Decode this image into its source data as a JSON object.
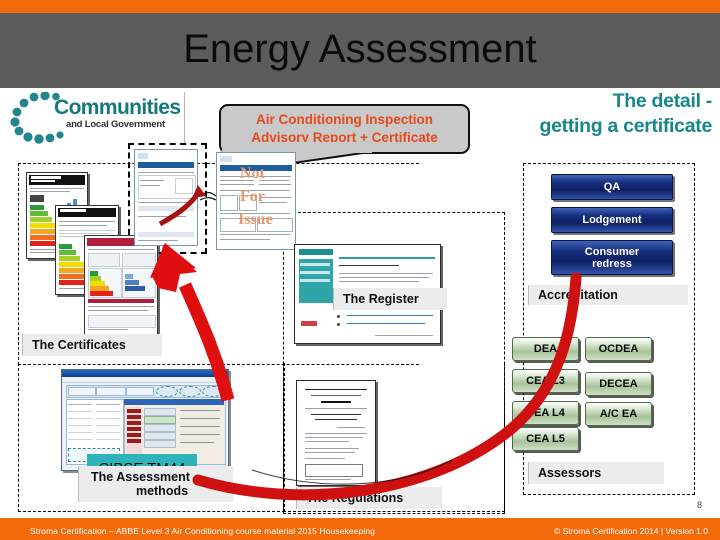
{
  "header": {
    "title": "Energy Assessment",
    "bar_color": "#f26a0a",
    "band_color": "#5c5c5c"
  },
  "logo": {
    "name": "Communities",
    "subtitle": "and Local Government",
    "color": "#13797f"
  },
  "callout": {
    "line1": "Air Conditioning Inspection",
    "line2": "Advisory Report + Certificate",
    "text_color": "#e8491c"
  },
  "right_heading": {
    "line1": "The detail -",
    "line2": "getting a certificate",
    "color": "#17878c"
  },
  "groups": {
    "certificates_label": "The Certificates",
    "register_label": "The Register",
    "assessment_label_line1": "The Assessment",
    "assessment_label_line2": "methods",
    "regulations_label": "The Regulations",
    "accreditation_label": "Accreditation",
    "assessors_label": "Assessors"
  },
  "stamp": {
    "line1": "Not",
    "line2": "For",
    "line3": "Issue"
  },
  "cibse": {
    "label": "CIBSE TM44",
    "color": "#2fb3bb"
  },
  "accreditation_buttons": [
    {
      "label": "QA"
    },
    {
      "label": "Lodgement"
    },
    {
      "label": "Consumer\nredress"
    }
  ],
  "accreditation_button_labels": {
    "qa": "QA",
    "lodgement": "Lodgement",
    "consumer_line1": "Consumer",
    "consumer_line2": "redress"
  },
  "assessor_buttons": {
    "col1": [
      "DEA",
      "CEA L3",
      "CEA L4",
      "CEA L5"
    ],
    "col2": [
      "OCDEA",
      "DECEA",
      "A/C EA"
    ]
  },
  "page_number": "8",
  "footer": {
    "left": "Stroma Certification – ABBE Level 3 Air Conditioning course material 2015 Housekeeping",
    "right": "© Stroma Certification 2014  |   Version 1.0"
  },
  "colors": {
    "accent_orange": "#f26a0a",
    "arrow_red": "#cf1010",
    "button_blue": "#17307e",
    "button_green": "#a8c39a",
    "teal": "#17878c"
  }
}
